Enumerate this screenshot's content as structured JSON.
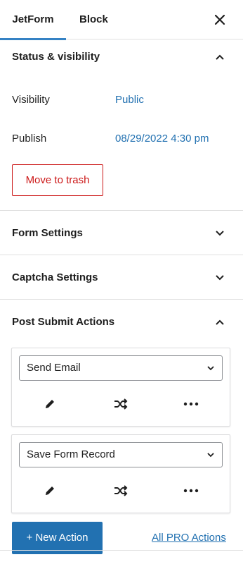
{
  "tabs": [
    {
      "label": "JetForm",
      "active": true
    },
    {
      "label": "Block",
      "active": false
    }
  ],
  "status_panel": {
    "title": "Status & visibility",
    "visibility_label": "Visibility",
    "visibility_value": "Public",
    "publish_label": "Publish",
    "publish_value": "08/29/2022 4:30 pm",
    "trash_label": "Move to trash"
  },
  "form_settings": {
    "title": "Form Settings"
  },
  "captcha_settings": {
    "title": "Captcha Settings"
  },
  "post_submit": {
    "title": "Post Submit Actions",
    "actions": [
      {
        "selected": "Send Email",
        "icons": [
          "pencil-icon",
          "shuffle-icon",
          "more-icon"
        ]
      },
      {
        "selected": "Save Form Record",
        "icons": [
          "pencil-icon",
          "shuffle-icon",
          "more-icon"
        ]
      }
    ],
    "new_action_label": "+ New Action",
    "pro_link_label": "All PRO Actions"
  },
  "colors": {
    "accent": "#2271b1",
    "tab_underline": "#3582c4",
    "danger": "#cc1818",
    "border": "#e0e0e0"
  }
}
